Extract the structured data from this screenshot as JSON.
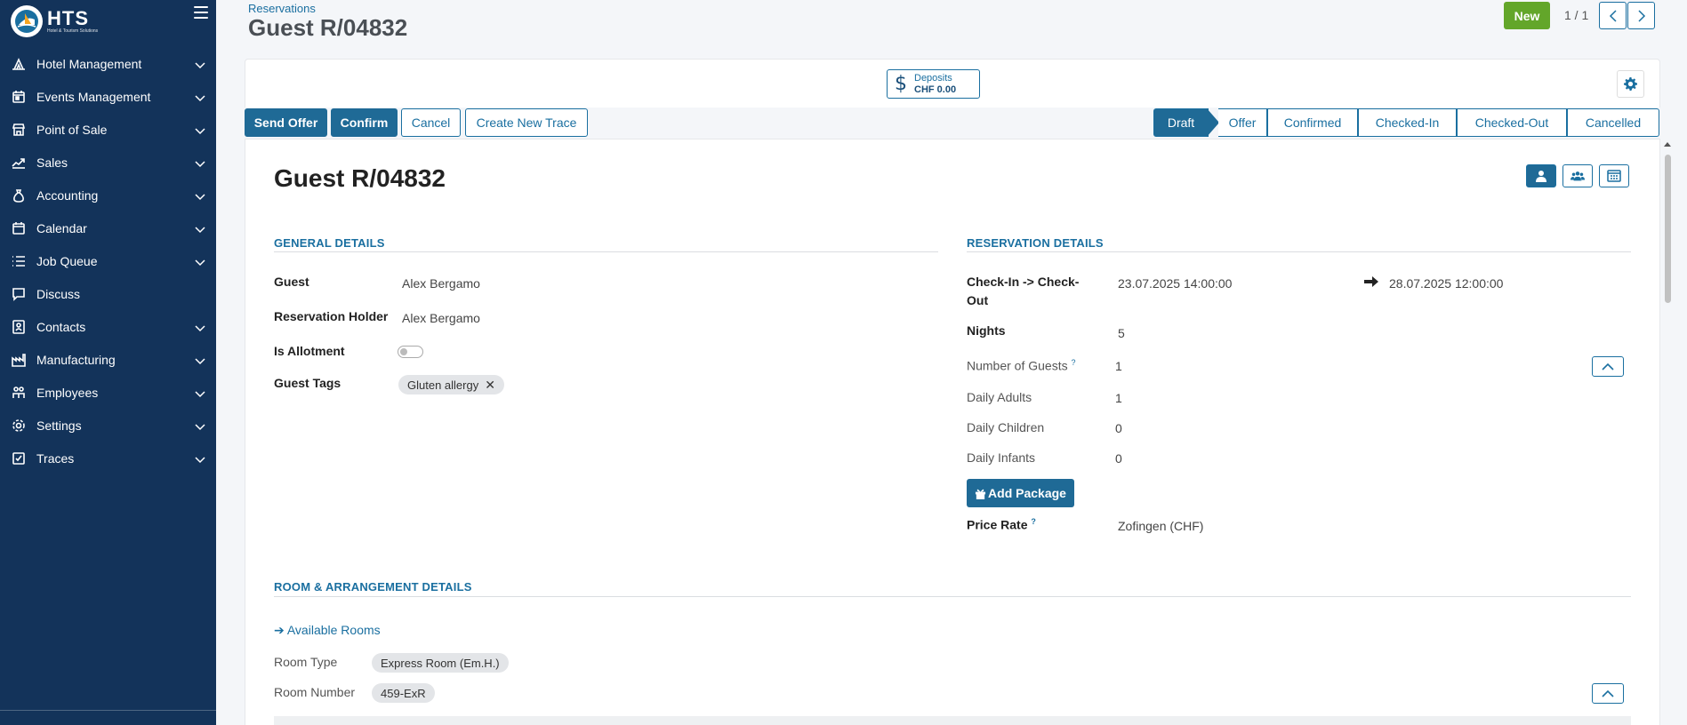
{
  "app": {
    "logo_text": "HTS",
    "logo_subtext": "Hotel & Tourism Solutions"
  },
  "sidebar": {
    "items": [
      {
        "label": "Hotel Management",
        "icon": "hotel-icon",
        "has_children": true
      },
      {
        "label": "Events Management",
        "icon": "calendar-event-icon",
        "has_children": true
      },
      {
        "label": "Point of Sale",
        "icon": "store-icon",
        "has_children": true
      },
      {
        "label": "Sales",
        "icon": "sales-icon",
        "has_children": true
      },
      {
        "label": "Accounting",
        "icon": "money-bag-icon",
        "has_children": true
      },
      {
        "label": "Calendar",
        "icon": "calendar-icon",
        "has_children": true
      },
      {
        "label": "Job Queue",
        "icon": "list-icon",
        "has_children": true
      },
      {
        "label": "Discuss",
        "icon": "chat-icon",
        "has_children": false
      },
      {
        "label": "Contacts",
        "icon": "contact-card-icon",
        "has_children": true
      },
      {
        "label": "Manufacturing",
        "icon": "factory-icon",
        "has_children": true
      },
      {
        "label": "Employees",
        "icon": "people-icon",
        "has_children": true
      },
      {
        "label": "Settings",
        "icon": "gear-icon",
        "has_children": true
      },
      {
        "label": "Traces",
        "icon": "checkbox-icon",
        "has_children": true
      }
    ]
  },
  "header": {
    "breadcrumb": "Reservations",
    "title": "Guest R/04832",
    "new_label": "New",
    "pager": "1 / 1"
  },
  "deposits": {
    "label": "Deposits",
    "amount": "CHF 0.00"
  },
  "actions": {
    "send_offer": "Send Offer",
    "confirm": "Confirm",
    "cancel": "Cancel",
    "create_trace": "Create New Trace"
  },
  "stages": [
    "Draft",
    "Offer",
    "Confirmed",
    "Checked-In",
    "Checked-Out",
    "Cancelled"
  ],
  "active_stage": "Draft",
  "sheet": {
    "title": "Guest R/04832"
  },
  "general": {
    "section_title": "GENERAL DETAILS",
    "guest_label": "Guest",
    "guest_value": "Alex Bergamo",
    "holder_label": "Reservation Holder",
    "holder_value": "Alex Bergamo",
    "allotment_label": "Is Allotment",
    "allotment_value": false,
    "tags_label": "Guest Tags",
    "tags": [
      "Gluten allergy"
    ]
  },
  "reservation": {
    "section_title": "RESERVATION DETAILS",
    "checkin_label_1": "Check-In -> Check-",
    "checkin_label_2": "Out",
    "checkin_value": "23.07.2025 14:00:00",
    "checkout_value": "28.07.2025 12:00:00",
    "nights_label": "Nights",
    "nights_value": "5",
    "num_guests_label": "Number of Guests",
    "num_guests_value": "1",
    "adults_label": "Daily Adults",
    "adults_value": "1",
    "children_label": "Daily Children",
    "children_value": "0",
    "infants_label": "Daily Infants",
    "infants_value": "0",
    "add_package": "Add Package",
    "price_rate_label": "Price Rate",
    "price_rate_value": "Zofingen (CHF)",
    "help_mark": "?"
  },
  "room": {
    "section_title": "ROOM & ARRANGEMENT DETAILS",
    "available_rooms": "➔ Available Rooms",
    "room_type_label": "Room Type",
    "room_type_value": "Express Room (Em.H.)",
    "room_number_label": "Room Number",
    "room_number_value": "459-ExR"
  },
  "colors": {
    "sidebar_bg": "#13335a",
    "primary": "#1f6a96",
    "new_button": "#63a62a"
  }
}
